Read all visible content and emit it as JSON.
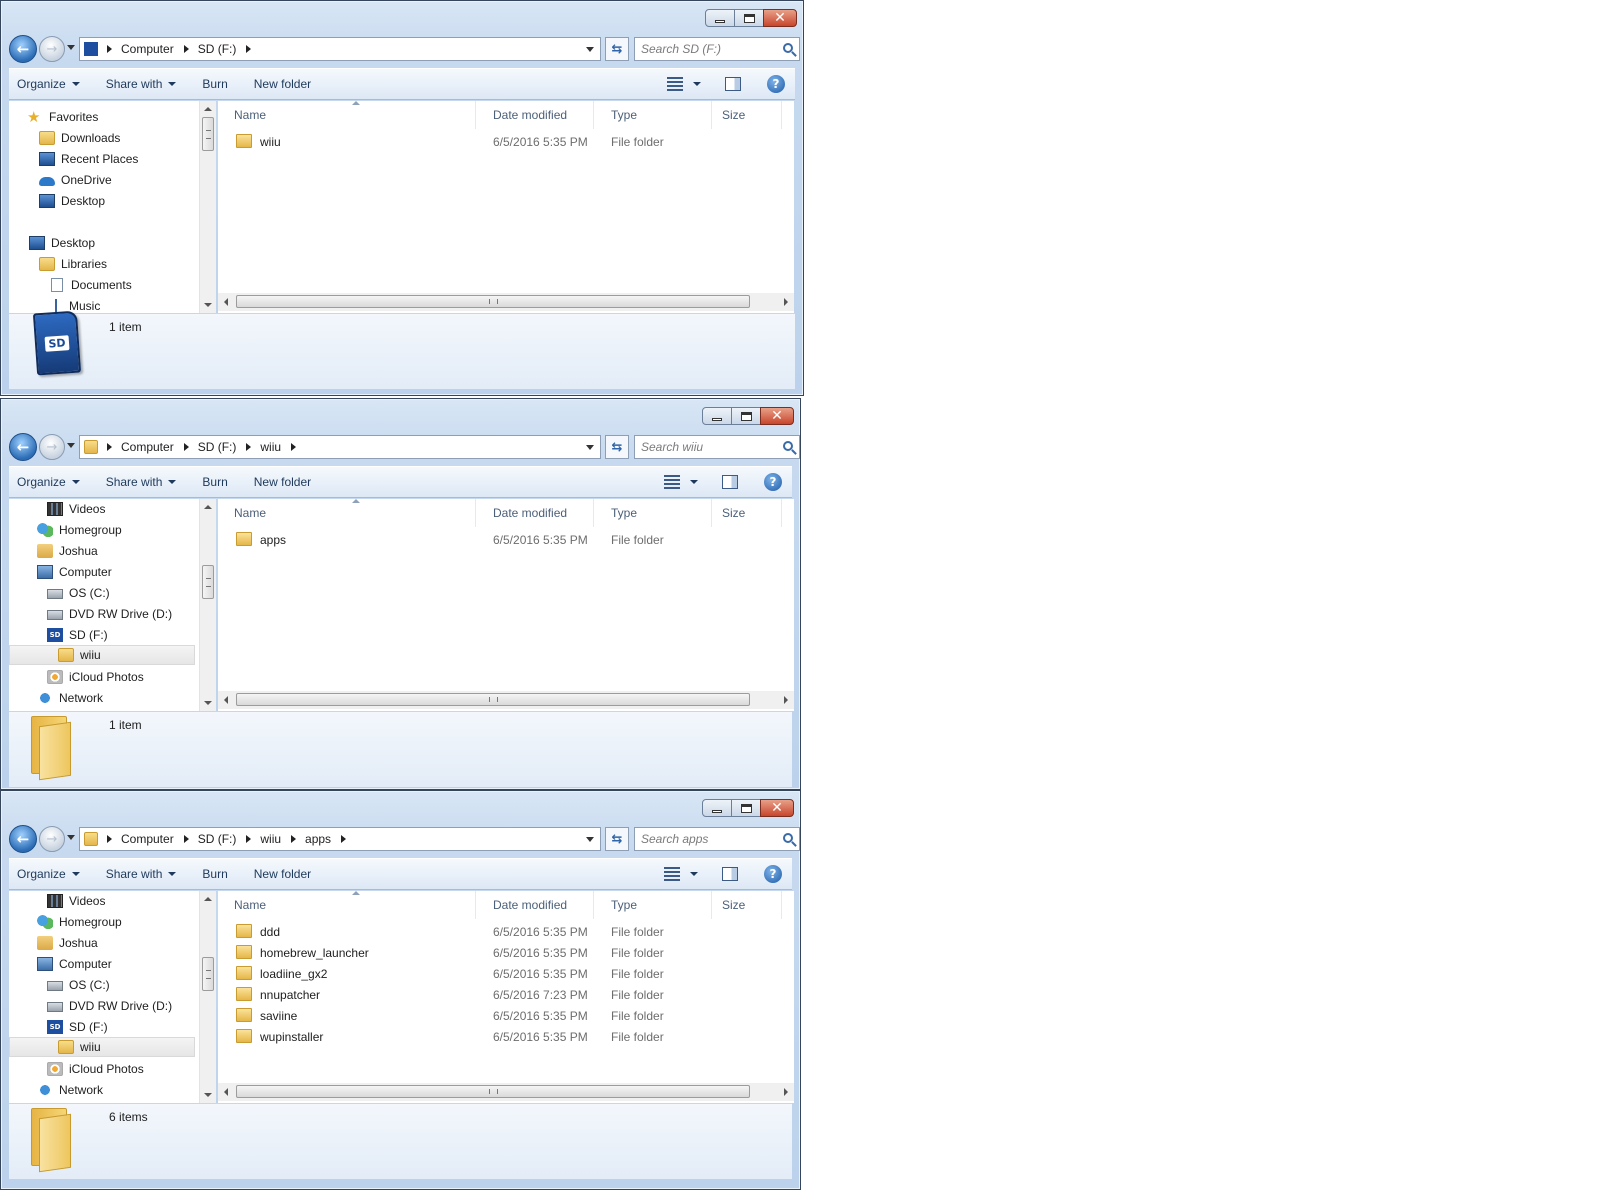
{
  "windows": [
    {
      "id": "sd-root",
      "breadcrumb": [
        "Computer",
        "SD (F:)"
      ],
      "search_placeholder": "Search SD (F:)",
      "toolbar": {
        "organize": "Organize",
        "share_with": "Share with",
        "burn": "Burn",
        "new_folder": "New folder"
      },
      "columns": {
        "name": "Name",
        "date_modified": "Date modified",
        "type": "Type",
        "size": "Size"
      },
      "nav_items": [
        {
          "label": "Favorites",
          "icon": "star-icon"
        },
        {
          "label": "Downloads",
          "icon": "downloads-folder-icon"
        },
        {
          "label": "Recent Places",
          "icon": "recent-places-icon"
        },
        {
          "label": "OneDrive",
          "icon": "onedrive-cloud-icon"
        },
        {
          "label": "Desktop",
          "icon": "desktop-icon"
        },
        {
          "label": "Desktop",
          "icon": "desktop-icon"
        },
        {
          "label": "Libraries",
          "icon": "libraries-icon"
        },
        {
          "label": "Documents",
          "icon": "documents-icon"
        },
        {
          "label": "Music",
          "icon": "music-icon"
        }
      ],
      "files": [
        {
          "name": "wiiu",
          "date": "6/5/2016 5:35 PM",
          "type": "File folder"
        }
      ],
      "status": "1 item",
      "details_icon": "sd-card-icon"
    },
    {
      "id": "wiiu",
      "breadcrumb": [
        "Computer",
        "SD (F:)",
        "wiiu"
      ],
      "search_placeholder": "Search wiiu",
      "toolbar": {
        "organize": "Organize",
        "share_with": "Share with",
        "burn": "Burn",
        "new_folder": "New folder"
      },
      "columns": {
        "name": "Name",
        "date_modified": "Date modified",
        "type": "Type",
        "size": "Size"
      },
      "nav_items": [
        {
          "label": "Videos",
          "icon": "videos-icon"
        },
        {
          "label": "Homegroup",
          "icon": "homegroup-icon"
        },
        {
          "label": "Joshua",
          "icon": "user-folder-icon"
        },
        {
          "label": "Computer",
          "icon": "computer-icon"
        },
        {
          "label": "OS (C:)",
          "icon": "drive-icon"
        },
        {
          "label": "DVD RW Drive (D:)",
          "icon": "dvd-drive-icon"
        },
        {
          "label": "SD (F:)",
          "icon": "sd-card-icon"
        },
        {
          "label": "wiiu",
          "icon": "folder-icon",
          "selected": true
        },
        {
          "label": "iCloud Photos",
          "icon": "icloud-photos-icon"
        },
        {
          "label": "Network",
          "icon": "network-icon"
        }
      ],
      "files": [
        {
          "name": "apps",
          "date": "6/5/2016 5:35 PM",
          "type": "File folder"
        }
      ],
      "status": "1 item",
      "details_icon": "folder-icon"
    },
    {
      "id": "apps",
      "breadcrumb": [
        "Computer",
        "SD (F:)",
        "wiiu",
        "apps"
      ],
      "search_placeholder": "Search apps",
      "toolbar": {
        "organize": "Organize",
        "share_with": "Share with",
        "burn": "Burn",
        "new_folder": "New folder"
      },
      "columns": {
        "name": "Name",
        "date_modified": "Date modified",
        "type": "Type",
        "size": "Size"
      },
      "nav_items": [
        {
          "label": "Videos",
          "icon": "videos-icon"
        },
        {
          "label": "Homegroup",
          "icon": "homegroup-icon"
        },
        {
          "label": "Joshua",
          "icon": "user-folder-icon"
        },
        {
          "label": "Computer",
          "icon": "computer-icon"
        },
        {
          "label": "OS (C:)",
          "icon": "drive-icon"
        },
        {
          "label": "DVD RW Drive (D:)",
          "icon": "dvd-drive-icon"
        },
        {
          "label": "SD (F:)",
          "icon": "sd-card-icon"
        },
        {
          "label": "wiiu",
          "icon": "folder-icon",
          "selected": true
        },
        {
          "label": "iCloud Photos",
          "icon": "icloud-photos-icon"
        },
        {
          "label": "Network",
          "icon": "network-icon"
        }
      ],
      "files": [
        {
          "name": "ddd",
          "date": "6/5/2016 5:35 PM",
          "type": "File folder"
        },
        {
          "name": "homebrew_launcher",
          "date": "6/5/2016 5:35 PM",
          "type": "File folder"
        },
        {
          "name": "loadiine_gx2",
          "date": "6/5/2016 5:35 PM",
          "type": "File folder"
        },
        {
          "name": "nnupatcher",
          "date": "6/5/2016 7:23 PM",
          "type": "File folder"
        },
        {
          "name": "saviine",
          "date": "6/5/2016 5:35 PM",
          "type": "File folder"
        },
        {
          "name": "wupinstaller",
          "date": "6/5/2016 5:35 PM",
          "type": "File folder"
        }
      ],
      "status": "6 items",
      "details_icon": "folder-icon"
    }
  ],
  "sd_card_label": "SD"
}
